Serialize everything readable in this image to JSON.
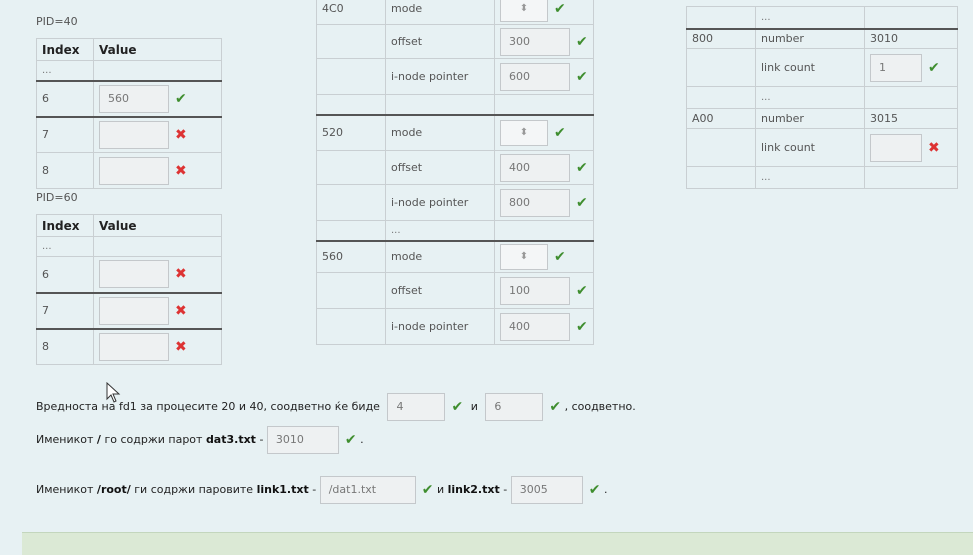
{
  "pid40": {
    "label": "PID=40",
    "header": {
      "index": "Index",
      "value": "Value"
    },
    "rows": [
      {
        "index": "...",
        "value": "",
        "mark": ""
      },
      {
        "index": "6",
        "value": "560",
        "mark": "ok"
      },
      {
        "index": "7",
        "value": "",
        "mark": "bad"
      },
      {
        "index": "8",
        "value": "",
        "mark": "bad"
      }
    ]
  },
  "pid60": {
    "label": "PID=60",
    "header": {
      "index": "Index",
      "value": "Value"
    },
    "rows": [
      {
        "index": "...",
        "value": "",
        "mark": ""
      },
      {
        "index": "6",
        "value": "",
        "mark": "bad"
      },
      {
        "index": "7",
        "value": "",
        "mark": "bad"
      },
      {
        "index": "8",
        "value": "",
        "mark": "bad"
      }
    ]
  },
  "fileTable": {
    "groups": [
      {
        "addr": "4C0",
        "rows": [
          {
            "field": "mode",
            "value": "",
            "type": "select",
            "mark": "ok"
          },
          {
            "field": "offset",
            "value": "300",
            "type": "input",
            "mark": "ok"
          },
          {
            "field": "i-node pointer",
            "value": "600",
            "type": "input",
            "mark": "ok"
          }
        ]
      },
      {
        "addr": "520",
        "rows": [
          {
            "field": "mode",
            "value": "",
            "type": "select",
            "mark": "ok"
          },
          {
            "field": "offset",
            "value": "400",
            "type": "input",
            "mark": "ok"
          },
          {
            "field": "i-node pointer",
            "value": "800",
            "type": "input",
            "mark": "ok"
          },
          {
            "field": "...",
            "value": "",
            "type": "none",
            "mark": ""
          }
        ]
      },
      {
        "addr": "560",
        "rows": [
          {
            "field": "mode",
            "value": "",
            "type": "select",
            "mark": "ok"
          },
          {
            "field": "offset",
            "value": "100",
            "type": "input",
            "mark": "ok"
          },
          {
            "field": "i-node pointer",
            "value": "400",
            "type": "input",
            "mark": "ok"
          }
        ]
      }
    ]
  },
  "inodeTable": {
    "dots": "...",
    "entries": [
      {
        "addr": "800",
        "number_label": "number",
        "number": "3010",
        "link_label": "link count",
        "link_value": "1",
        "link_mark": "ok"
      },
      {
        "addr": "A00",
        "number_label": "number",
        "number": "3015",
        "link_label": "link count",
        "link_value": "",
        "link_mark": "bad"
      }
    ]
  },
  "q1": {
    "text_a": "Вредноста на fd1 за процесите 20 и 40, соодветно ќе биде",
    "val1": "4",
    "conj": "и",
    "val2": "6",
    "text_b": ", соодветно."
  },
  "q2": {
    "text_a": "Именикот",
    "dir": "/",
    "text_b": "го содржи парот",
    "file": "dat3.txt",
    "dash": "-",
    "val": "3010",
    "end": "."
  },
  "q3": {
    "text_a": "Именикот",
    "dir": "/root/",
    "text_b": "ги содржи паровите",
    "file1": "link1.txt",
    "dash1": "-",
    "val1": "/dat1.txt",
    "conj": "и",
    "file2": "link2.txt",
    "dash2": "-",
    "val2": "3005",
    "end": "."
  },
  "icons": {
    "ok": "✔",
    "bad": "✖",
    "spinner": "⬍"
  }
}
